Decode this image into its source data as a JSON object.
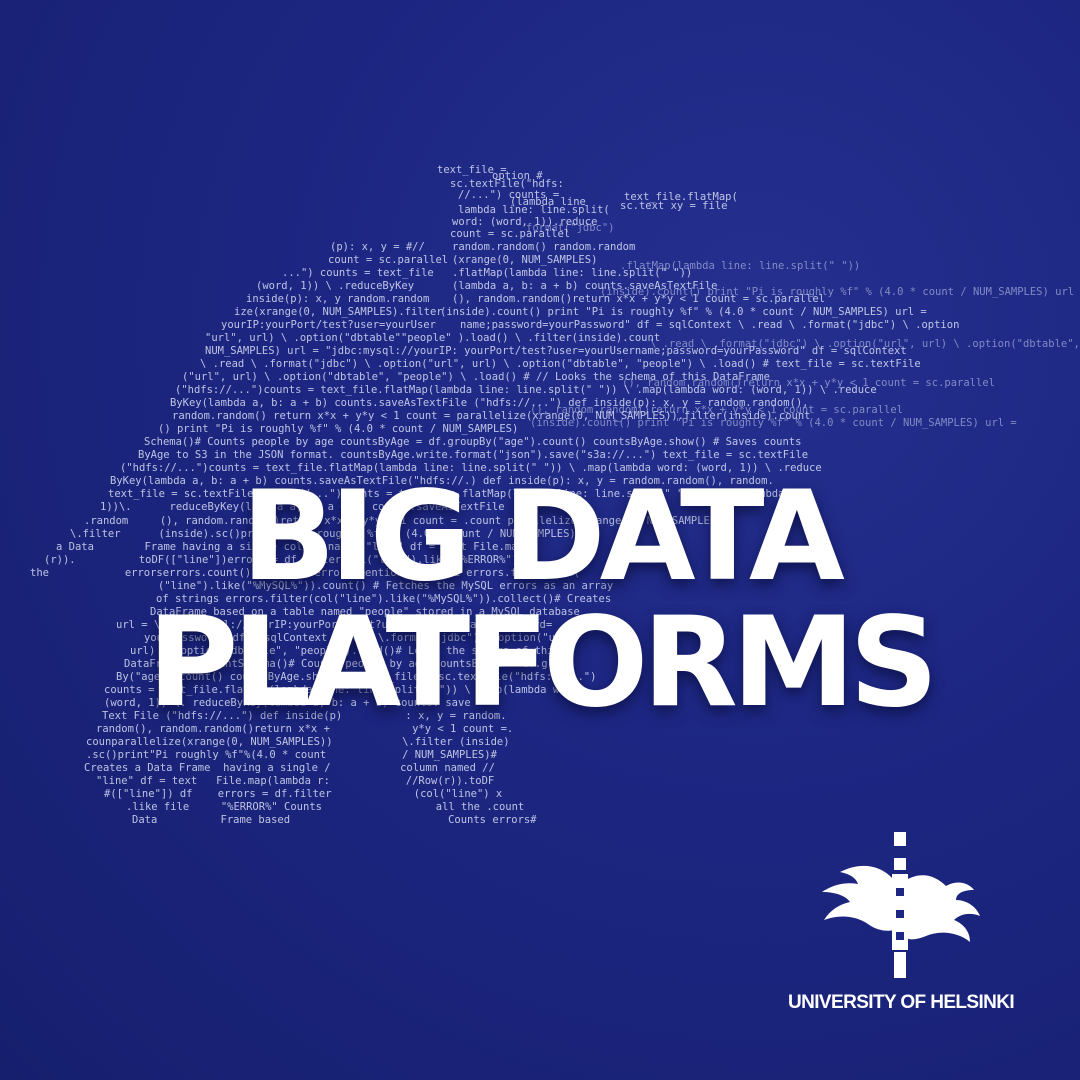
{
  "title": {
    "line1": "BIG DATA",
    "line2": "PLATFORMS"
  },
  "brand": {
    "name": "UNIVERSITY OF HELSINKI",
    "logo_icon": "flame-torch-logo-icon"
  },
  "colors": {
    "background": "#1d2783",
    "text": "#ffffff"
  },
  "code_snippets": [
    "text_file =",
    "option #",
    "sc.textFile(\"hdfs:",
    "//...\") counts =",
    "(lambda line",
    "text_file.flatMap(",
    "sc.text xy = file",
    "lambda line: line.split(",
    "word: (word, 1)).reduce",
    "(p): x, y = #//",
    "random.random() random.random",
    "count = sc.parallel",
    "(xrange(0, NUM_SAMPLES)",
    "...\") counts = text_file",
    ".flatMap(lambda line: line.split(\" \"))",
    "(word, 1)) \\ .reduceByKey",
    "(lambda a, b: a + b) counts.saveAsTextFile",
    "inside(p): x, y random.random",
    "(), random.random()return x*x + y*y < 1 count = sc.parallel",
    "ize(xrange(0, NUM_SAMPLES).filter",
    "(inside).count() print \"Pi is roughly %f\" % (4.0 * count / NUM_SAMPLES) url =",
    "yourIP:yourPort/test?user=yourUser",
    "name;password=yourPassword\" df = sqlContext \\ .read \\ .format(\"jdbc\") \\ .option",
    "\"url\", url) \\ .option(\"dbtable\"\"people\" ).load() \\ .filter(inside).count",
    "NUM_SAMPLES) url = \"jdbc:mysql://yourIP: yourPort/test?user=yourUsername;password=yourPassword\" df = sqlContext",
    "\\ .read \\ .format(\"jdbc\") \\ .option(\"url\", url) \\ .option(\"dbtable\", \"people\") \\ .load() # text_file = sc.textFile",
    "(\"url\", url) \\ .option(\"dbtable\", \"people\") \\ .load() # // Looks the schema of this DataFrame",
    "(\"hdfs://...\")counts = text_file.flatMap(lambda line: line.split(\" \")) \\ .map(lambda word: (word, 1)) \\ .reduce",
    "ByKey(lambda a, b: a + b) counts.saveAsTextFile (\"hdfs://...\") def inside(p): x, y = random.random(),",
    "random.random() return x*x + y*y < 1 count = parallelize(xrange(0, NUM_SAMPLES)).filter(inside).count",
    "() print \"Pi is roughly %f\" % (4.0 * count / NUM_SAMPLES)",
    "Schema()# Counts people by age countsByAge = df.groupBy(\"age\").count() countsByAge.show() # Saves counts",
    "ByAge to S3 in the JSON format. countsByAge.write.format(\"json\").save(\"s3a://...\") text_file = sc.textFile",
    "(\"hdfs://...\")counts = text_file.flatMap(lambda line: line.split(\" \")) \\ .map(lambda word: (word, 1)) \\ .reduce",
    "ByKey(lambda a, b: a + b) counts.saveAsTextFile(\"hdfs://.) def inside(p): x, y = random.random(), random.",
    "text_file = sc.textFile(\"hdfs://...\")counts = text_file.flatMap(lambda line: line.split(\" \")) \\ .map(lambda",
    "1))\\.      reduceByKey(lambda a, b: a + b) counts.saveAsTextFile",
    ".random     (), random.random()return x*x + y*y < 1 count = .count parallelize(xrange(0, NUM_SAMPLES)",
    "\\.filter      (inside).sc()print\"Pi is roughly %f\" % (4.0 * count / NUM_SAMPLES)",
    "a Data        Frame having a single column named \"line\" df = text File.map(",
    "(r)).          toDF([\"line\"])errors = df.filter(col(\"line\").like(\"%ERROR%\"))",
    "the            errorserrors.count() # Counts errors mentioning MySQL errors.filter(col(",
    "(\"line\").like(\"%MySQL%\")).count() # Fetches the MySQL errors as an array",
    "of strings errors.filter(col(\"line\").like(\"%MySQL%\")).collect()# Creates",
    "DataFrame based on a table named \"people\" stored in a MySQL database",
    "url = \\\"jdbc:mysql://yourIP:yourPort/test?user=yourUsername;password=",
    "yourPassword\" df = sqlContext \\.read \\.format(\"jdbc\") \\.option(\"url\",",
    "url) \\ .option(\"dbtable\", \"people\").load()# Looks the schema of this",
    "DataFrame.df.printSchema()# Counts people by age countsByAge = df.group",
    "By(\"age\").count() countsByAge.show() # text_file = sc.textFile(\"hdfs://...\")",
    "counts = text_file.flatMap(lambda line: line.split(\" \")) \\ .map(lambda wo",
    "(word, 1)) \\. reduceByKey(lambda a, b: a + b) counts. save",
    "Text File (\"hdfs://...\") def inside(p)          : x, y = random.",
    "random(), random.random()return x*x +             y*y < 1 count =.",
    "counparallelize(xrange(0, NUM_SAMPLES))           \\.filter (inside)",
    ".sc()print\"Pi roughly %f\"%(4.0 * count            / NUM_SAMPLES)#",
    "Creates a Data Frame  having a single /           column named //",
    "\"line\" df = text   File.map(lambda r:            //Row(r)).toDF",
    "#([\"line\"]) df    errors = df.filter             (col(\"line\") x",
    ".like file     \"%ERROR%\" Counts                  all the .count",
    "Data          Frame based                         Counts errors#",
    "\"line\").like ...",
    "File(\"hdfs:",
    "(lambda line:",
    "count = sc.text",
    "line.split(\" \")",
    "text file",
    "format(\"jdbc\")"
  ]
}
